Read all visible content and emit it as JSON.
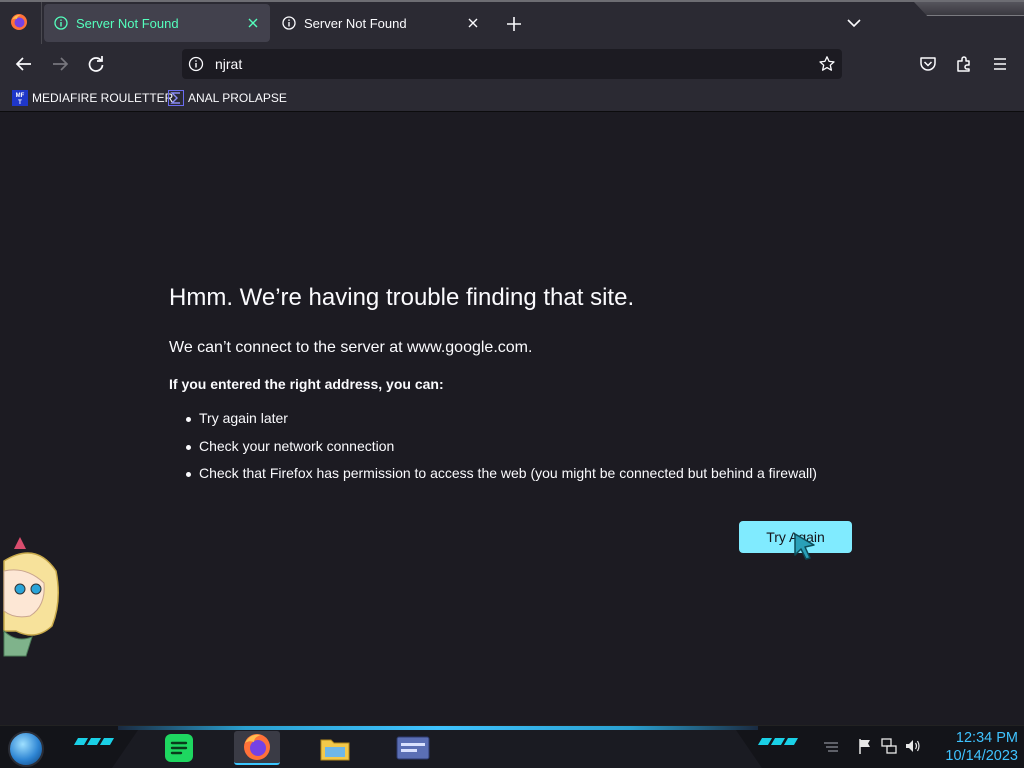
{
  "tabs": [
    {
      "title": "Server Not Found",
      "active": true
    },
    {
      "title": "Server Not Found",
      "active": false
    }
  ],
  "urlbar": {
    "value": "njrat"
  },
  "bookmarks": [
    {
      "label": "MEDIAFIRE ROULETTER",
      "icon": "mediafire-favicon"
    },
    {
      "label": "ANAL PROLAPSE",
      "icon": "sigma-favicon"
    }
  ],
  "error": {
    "title": "Hmm. We’re having trouble finding that site.",
    "description": "We can’t connect to the server at www.google.com.",
    "subtitle": "If you entered the right address, you can:",
    "suggestions": [
      "Try again later",
      "Check your network connection",
      "Check that Firefox has permission to access the web (you might be connected but behind a firewall)"
    ],
    "button_label": "Try Again"
  },
  "taskbar": {
    "apps": [
      "spotify",
      "firefox",
      "file-explorer",
      "control-panel"
    ],
    "clock": {
      "time": "12:34 PM",
      "date": "10/14/2023"
    }
  },
  "colors": {
    "chrome": "#2b2a33",
    "content_bg": "#1c1b22",
    "active_tab_text": "#54ffbd",
    "button_bg": "#80ebff",
    "clock": "#3fc3ff"
  }
}
